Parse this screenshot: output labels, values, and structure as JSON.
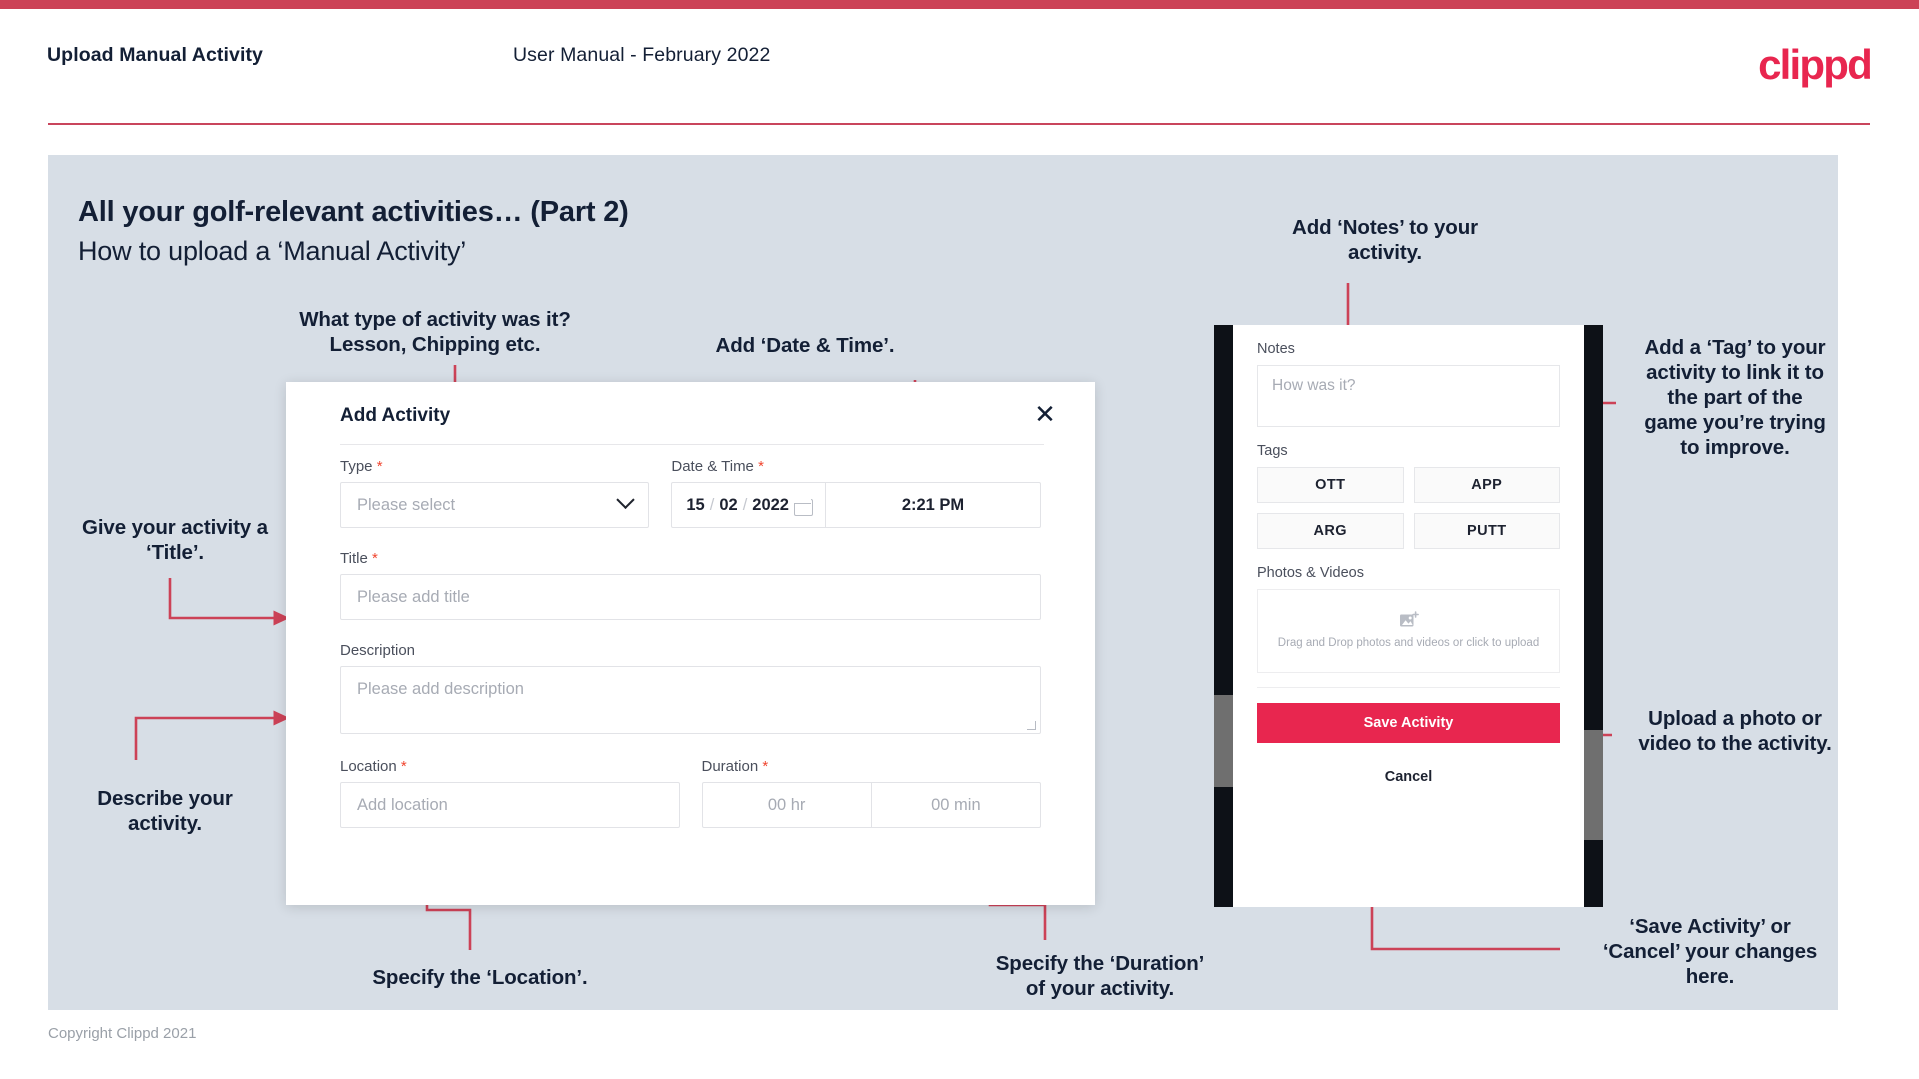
{
  "header": {
    "title": "Upload Manual Activity",
    "subtitle": "User Manual - February 2022",
    "logo": "clippd"
  },
  "slide": {
    "title": "All your golf-relevant activities… (Part 2)",
    "subtitle": "How to upload a ‘Manual Activity’"
  },
  "annotations": {
    "type": "What type of activity was it?\nLesson, Chipping etc.",
    "datetime": "Add ‘Date & Time’.",
    "title": "Give your activity a\n‘Title’.",
    "description": "Describe your\nactivity.",
    "location": "Specify the ‘Location’.",
    "duration": "Specify the ‘Duration’\nof your activity.",
    "notes": "Add ‘Notes’ to your\nactivity.",
    "tag": "Add a ‘Tag’ to your\nactivity to link it to\nthe part of the\ngame you’re trying\nto improve.",
    "upload": "Upload a photo or\nvideo to the activity.",
    "save": "‘Save Activity’ or\n‘Cancel’ your changes\nhere."
  },
  "dialog": {
    "title": "Add Activity",
    "close_icon": "close-icon",
    "fields": {
      "type": {
        "label": "Type",
        "required": "*",
        "placeholder": "Please select"
      },
      "datetime": {
        "label": "Date & Time",
        "required": "*",
        "day": "15",
        "month": "02",
        "year": "2022",
        "sep": "/",
        "time": "2:21 PM",
        "calendar_icon": "calendar-icon"
      },
      "title": {
        "label": "Title",
        "required": "*",
        "placeholder": "Please add title"
      },
      "description": {
        "label": "Description",
        "required": "",
        "placeholder": "Please add description"
      },
      "location": {
        "label": "Location",
        "required": "*",
        "placeholder": "Add location"
      },
      "duration": {
        "label": "Duration",
        "required": "*",
        "hours": "00 hr",
        "minutes": "00 min"
      }
    }
  },
  "phone": {
    "notes_label": "Notes",
    "notes_placeholder": "How was it?",
    "tags_label": "Tags",
    "tags": [
      "OTT",
      "APP",
      "ARG",
      "PUTT"
    ],
    "photos_label": "Photos & Videos",
    "dropzone_text": "Drag and Drop photos and videos or click to upload",
    "dropzone_icon": "add-image-icon",
    "save_label": "Save Activity",
    "cancel_label": "Cancel"
  },
  "footer": {
    "copyright": "Copyright Clippd 2021"
  },
  "colors": {
    "brand_red": "#e8264f",
    "bar_red": "#cc4257",
    "arrow_red": "#cc4257",
    "canvas": "#d7dee6",
    "ink": "#131f35"
  }
}
